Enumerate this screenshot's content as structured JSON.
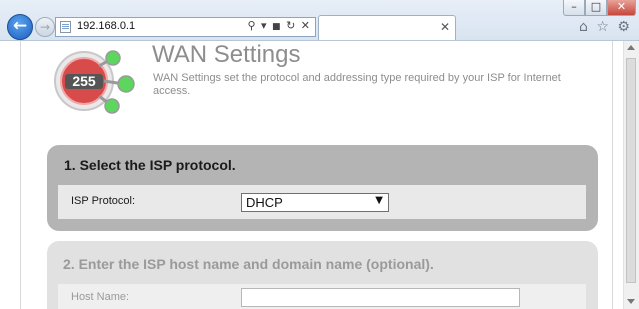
{
  "browser": {
    "address": "192.168.0.1",
    "window_buttons": {
      "minimize": "–",
      "maximize": "□",
      "close": "✕"
    },
    "nav": {
      "back": "←",
      "forward": "→"
    },
    "address_icons": {
      "search": "⚲",
      "dropdown": "▾",
      "lock": "🔒",
      "refresh": "↻",
      "stop": "✕"
    },
    "tab_close": "✕",
    "tools": {
      "home": "⌂",
      "favorites": "☆",
      "settings": "⚙"
    }
  },
  "header": {
    "logo_text": "255",
    "title": "WAN Settings",
    "description": "WAN Settings set the protocol and addressing type required by your ISP for Internet access."
  },
  "section1": {
    "title": "1. Select the ISP protocol.",
    "isp_label": "ISP Protocol:",
    "isp_value": "DHCP",
    "select_arrow": "▼"
  },
  "section2": {
    "title": "2. Enter the ISP host name and domain name (optional).",
    "host_label": "Host Name:",
    "host_value": ""
  },
  "colors": {
    "accent_blue": "#1d5fbf",
    "panel_active": "#b4b4b4",
    "panel_inactive": "#e1e1e1",
    "logo_red": "#d84b4b",
    "logo_green": "#5cd65c"
  }
}
